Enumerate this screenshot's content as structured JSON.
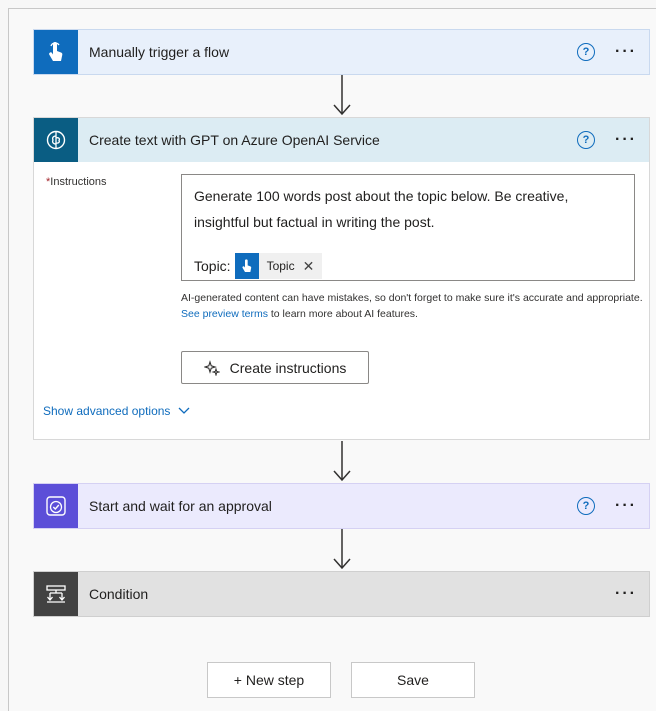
{
  "colors": {
    "trigger_header_bg": "#e8f0fb",
    "trigger_icon_bg": "#0f6cbd",
    "openai_header_bg": "#dcecf3",
    "openai_icon_bg": "#0a5d83",
    "approval_header_bg": "#ebeafd",
    "approval_icon_bg": "#5c4fd8",
    "condition_header_bg": "#e1e1e1",
    "condition_icon_bg": "#424242",
    "link": "#0f6cbd"
  },
  "steps": {
    "trigger": {
      "title": "Manually trigger a flow",
      "icon": "touch-hand-icon",
      "help": "?",
      "more": "···"
    },
    "openai": {
      "title": "Create text with GPT on Azure OpenAI Service",
      "icon": "openai-brain-icon",
      "help": "?",
      "more": "···"
    },
    "approval": {
      "title": "Start and wait for an approval",
      "icon": "approval-check-icon",
      "help": "?",
      "more": "···"
    },
    "condition": {
      "title": "Condition",
      "icon": "condition-branch-icon",
      "more": "···"
    }
  },
  "openai_form": {
    "required_marker": "*",
    "instructions_label": "Instructions",
    "instructions_text": "Generate 100 words post about the topic below. Be creative, insightful but factual in writing the post.",
    "topic_prefix": "Topic:",
    "topic_token": "Topic",
    "token_remove": "✕",
    "disclaimer_pre": "AI-generated content can have mistakes, so don't forget to make sure it's accurate and appropriate. ",
    "disclaimer_link": "See preview terms",
    "disclaimer_post": " to learn more about AI features.",
    "create_instructions": "Create instructions",
    "show_advanced": "Show advanced options"
  },
  "footer": {
    "new_step": "+ New step",
    "save": "Save"
  }
}
